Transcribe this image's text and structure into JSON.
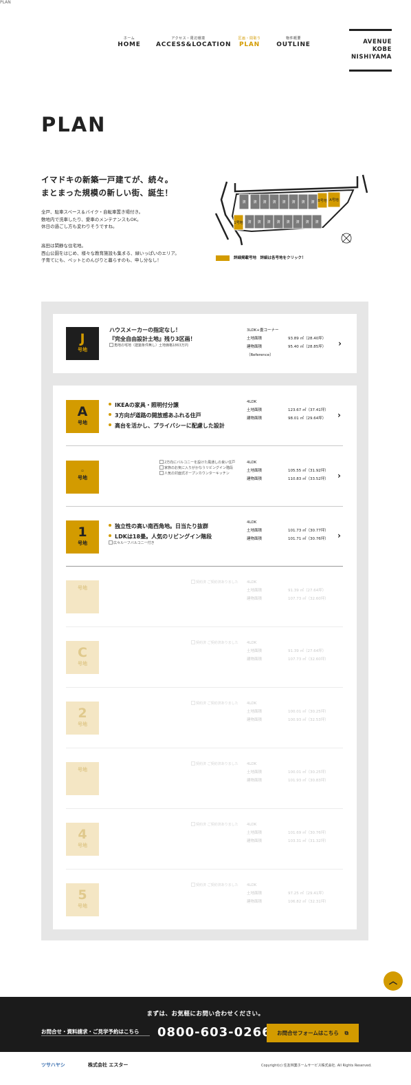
{
  "top_image_alt": "PLAN",
  "nav": [
    {
      "sub": "ホーム",
      "label": "HOME"
    },
    {
      "sub": "アクセス・周辺環境",
      "label": "ACCESS&LOCATION"
    },
    {
      "sub": "区画・間取り",
      "label": "PLAN"
    },
    {
      "sub": "物件概要",
      "label": "OUTLINE"
    }
  ],
  "logo": [
    "AVENUE",
    "KOBE",
    "NISHIYAMA"
  ],
  "page_title": "PLAN",
  "lead": {
    "heading1": "イマドキの新築一戸建てが、続々。",
    "heading2": "まとまった規模の新しい街、誕生！",
    "para1": [
      "全戸、駐車スペース＆バイク・自転車置き場付き。",
      "敷地内で洗車したり、愛車のメンテナンスもOK。",
      "休日の過ごし方も変わりそうですね。"
    ],
    "para2": [
      "高田は閑静な住宅地。",
      "西山公園をはじめ、様々な教育施設も集まる、緑いっぱいのエリア。",
      "子育てにも、ペットとのんびりと暮らすのも、申し分なし！"
    ]
  },
  "map": {
    "sold_label": "済",
    "lot_b": "B号地",
    "lot_a": "A号地",
    "lot_1": "1号地",
    "legend": "詳細掲載号地　詳細は各号地をクリック！"
  },
  "lots": [
    {
      "letter": "J",
      "go": "号地",
      "features": [
        "ハウスメーカーの指定なし！",
        "『完全自由設計土地』残り3区画！"
      ],
      "img_alt": "角地の宅地（建築条件無し）土地価格1863万円",
      "type": "3LDK+畳コーナー",
      "land_label": "土地面積",
      "land": "93.89 ㎡（28.40坪）",
      "building_label": "建物面積",
      "building": "95.40 ㎡（28.85坪）",
      "note": "（Reference）"
    },
    {
      "letter": "A",
      "go": "号地",
      "features": [
        "IKEAの家具・照明付分譲",
        "3方向が道路の開放感あふれる住戸",
        "高台を活かし、プライバシーに配慮した設計"
      ],
      "type": "4LDK",
      "land_label": "土地面積",
      "land": "123.67 ㎡（37.41坪）",
      "building_label": "建物面積",
      "building": "98.01 ㎡（29.64坪）"
    },
    {
      "letter": "B",
      "go": "号地",
      "img_alts": [
        "2方向にバルコニーを設けた風通しの良い住戸",
        "家族のお気に入りがかなうリビングイン階段",
        "人気の対面式オープンカウンターキッチン"
      ],
      "type": "4LDK",
      "land_label": "土地面積",
      "land": "105.55 ㎡（31.92坪）",
      "building_label": "建物面積",
      "building": "110.83 ㎡（33.52坪）"
    },
    {
      "letter": "1",
      "go": "号地",
      "features": [
        "独立性の高い南西角地。日当たり抜群",
        "LDKは18畳。人気のリビングイン階段"
      ],
      "img_alt": "広々ルーフバルコニー付き",
      "type": "4LDK",
      "land_label": "土地面積",
      "land": "101.73 ㎡（30.77坪）",
      "building_label": "建物面積",
      "building": "101.71 ㎡（30.76坪）"
    }
  ],
  "sold_lots": [
    {
      "letter": "",
      "go": "号地",
      "img_alt": "契約済 ご契約済ありました",
      "type": "4LDK",
      "land_label": "土地面積",
      "land": "91.39 ㎡（27.64坪）",
      "building_label": "建物面積",
      "building": "107.73 ㎡（32.60坪）"
    },
    {
      "letter": "C",
      "go": "号地",
      "img_alt": "契約済 ご契約済ありました",
      "type": "4LDK",
      "land_label": "土地面積",
      "land": "91.39 ㎡（27.64坪）",
      "building_label": "建物面積",
      "building": "107.73 ㎡（32.60坪）"
    },
    {
      "letter": "2",
      "go": "号地",
      "img_alt": "契約済 ご契約済ありました",
      "type": "4LDK",
      "land_label": "土地面積",
      "land": "100.01 ㎡（30.25坪）",
      "building_label": "建物面積",
      "building": "100.93 ㎡（32.53坪）"
    },
    {
      "letter": "",
      "go": "号地",
      "img_alt": "契約済 ご契約済ありました",
      "type": "4LDK",
      "land_label": "土地面積",
      "land": "100.01 ㎡（30.25坪）",
      "building_label": "建物面積",
      "building": "101.93 ㎡（30.83坪）"
    },
    {
      "letter": "4",
      "go": "号地",
      "img_alt": "契約済 ご契約済ありました",
      "type": "4LDK",
      "land_label": "土地面積",
      "land": "101.69 ㎡（30.76坪）",
      "building_label": "建物面積",
      "building": "103.31 ㎡（31.32坪）"
    },
    {
      "letter": "5",
      "go": "号地",
      "img_alt": "契約済 ご契約済ありました",
      "type": "4LDK",
      "land_label": "土地面積",
      "land": "97.25 ㎡（29.41坪）",
      "building_label": "建物面積",
      "building": "106.82 ㎡（32.31坪）"
    }
  ],
  "footer": {
    "message": "まずは、お気軽にお問い合わせください。",
    "request": "お問合せ・資料請求・ご見学予約はこちら",
    "tel": "0800-603-0266",
    "form_button": "お問合せフォームはこちら",
    "company1": "ツサハヤシ",
    "company2": "株式会社 エスター",
    "copyright": "Copyright(c) 住友林業ホームサービス株式会社. All Rights Reserved."
  },
  "colors": {
    "accent": "#d39b00",
    "dark": "#1b1b1b",
    "panel": "#e6e6e6"
  }
}
